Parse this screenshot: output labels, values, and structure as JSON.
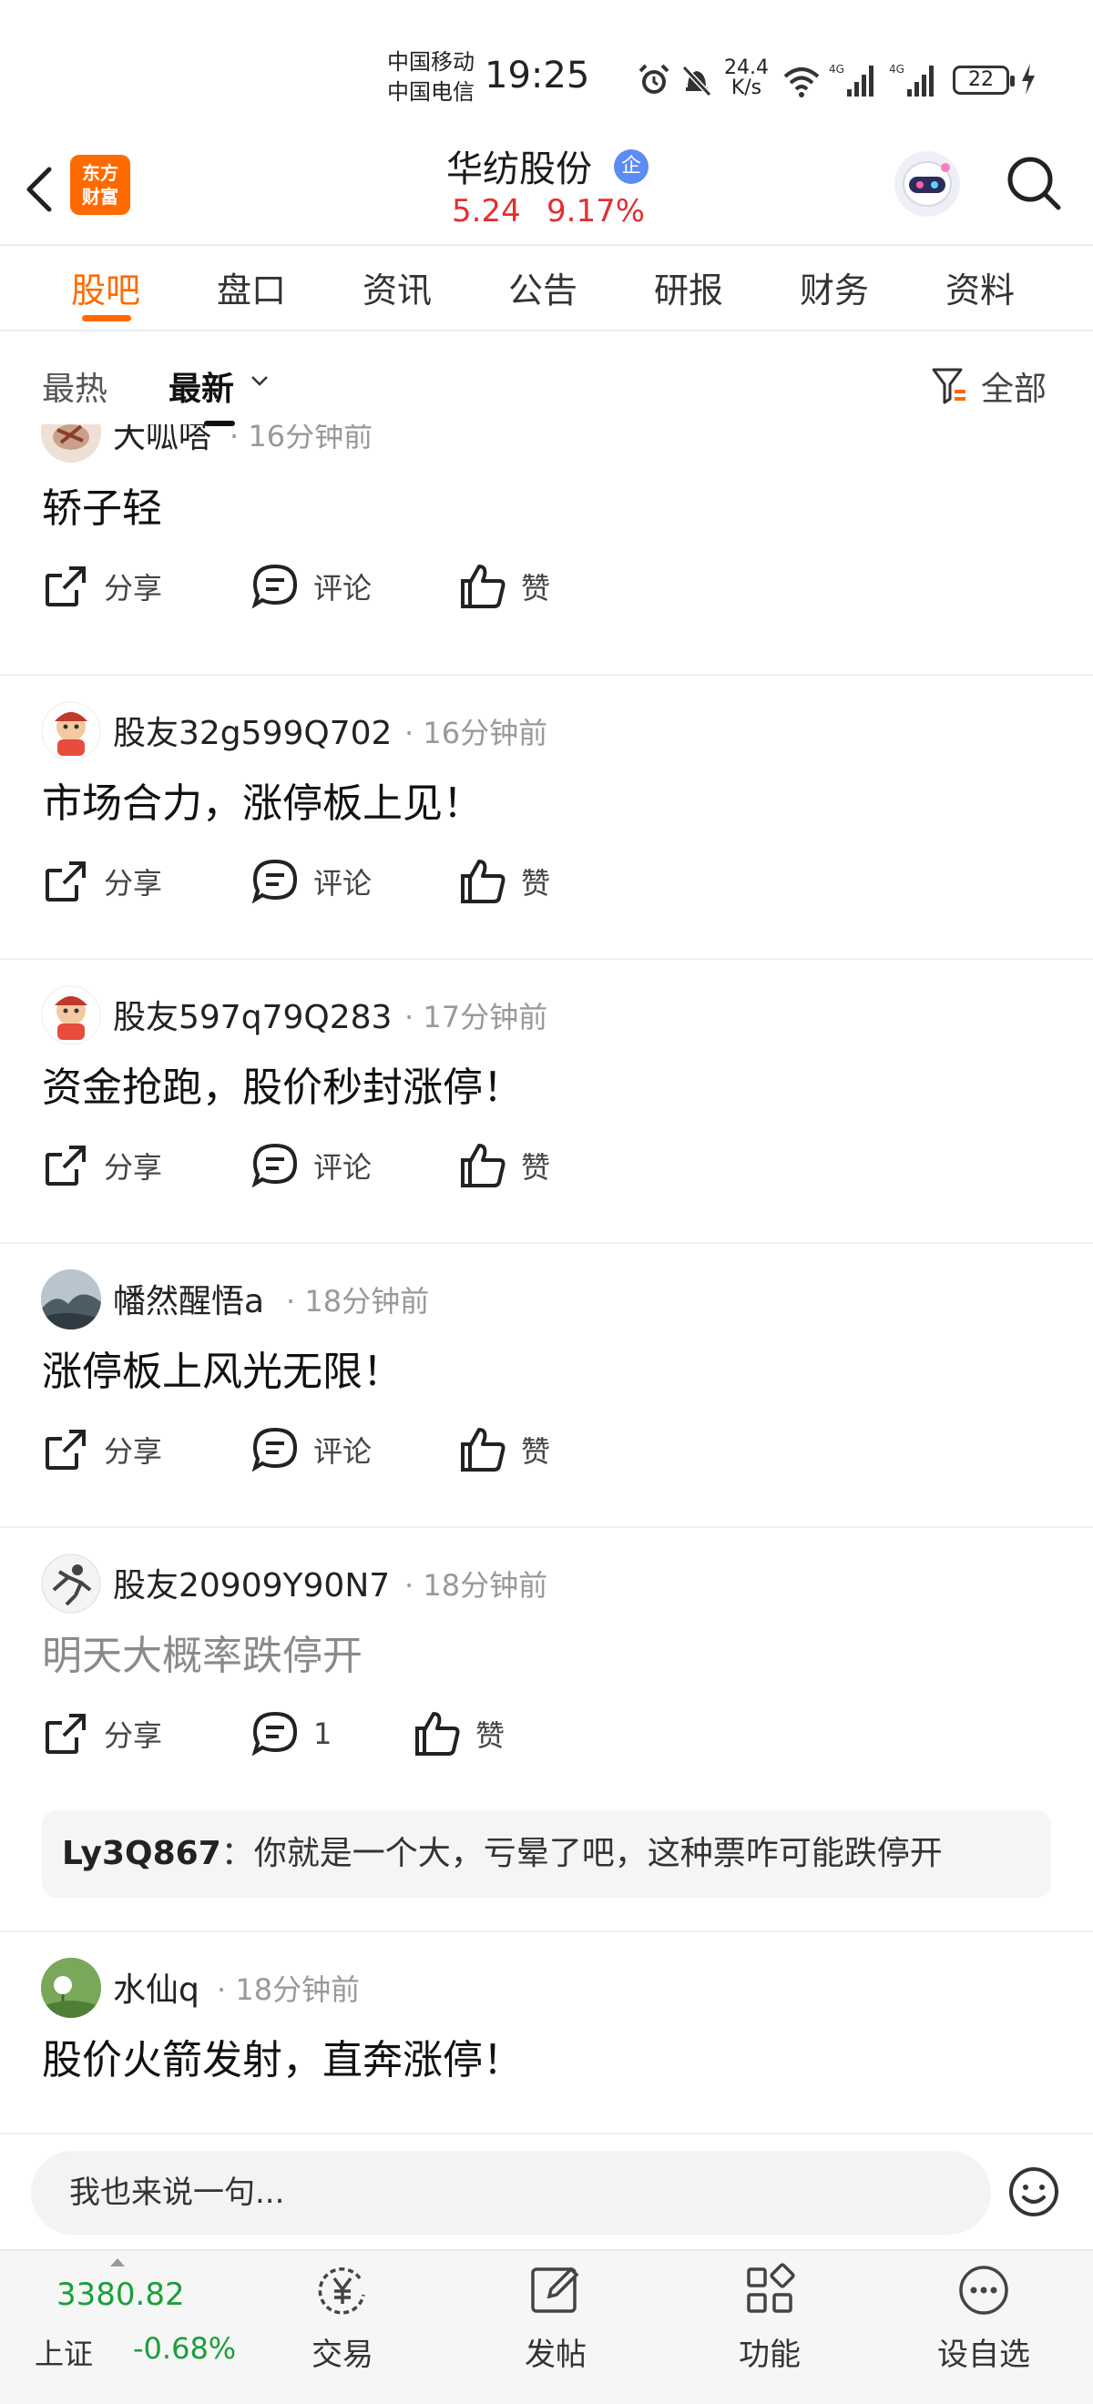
{
  "status_bar": {
    "carrier_1": "中国移动",
    "carrier_2": "中国电信",
    "time": "19:25",
    "net_speed_value": "24.4",
    "net_speed_unit": "K/s",
    "battery": "22"
  },
  "header": {
    "logo_text_1": "东方",
    "logo_text_2": "财富",
    "stock_name": "华纺股份",
    "badge": "企",
    "price": "5.24",
    "change_pct": "9.17%"
  },
  "tabs": [
    {
      "label": "股吧",
      "active": true
    },
    {
      "label": "盘口"
    },
    {
      "label": "资讯"
    },
    {
      "label": "公告"
    },
    {
      "label": "研报"
    },
    {
      "label": "财务"
    },
    {
      "label": "资料"
    }
  ],
  "sort": {
    "hot": "最热",
    "new": "最新",
    "filter": "全部"
  },
  "actions": {
    "share": "分享",
    "comment": "评论",
    "like": "赞"
  },
  "posts": [
    {
      "author": "大呱嗒",
      "time": "16分钟前",
      "content": "轿子轻",
      "comment_count": ""
    },
    {
      "author": "股友32g599Q702",
      "time": "16分钟前",
      "content": "市场合力，涨停板上见！",
      "comment_count": ""
    },
    {
      "author": "股友597q79Q283",
      "time": "17分钟前",
      "content": "资金抢跑，股价秒封涨停！",
      "comment_count": ""
    },
    {
      "author": "幡然醒悟a",
      "time": "18分钟前",
      "content": "涨停板上风光无限！",
      "comment_count": ""
    },
    {
      "author": "股友20909Y90N7",
      "time": "18分钟前",
      "content": "明天大概率跌停开",
      "comment_count": "1",
      "reply": {
        "user": "Ly3Q867",
        "text": "：你就是一个大，亏晕了吧，这种票咋可能跌停开"
      }
    },
    {
      "author": "水仙q",
      "time": "18分钟前",
      "content": "股价火箭发射，直奔涨停！",
      "comment_count": ""
    }
  ],
  "input": {
    "placeholder": "我也来说一句..."
  },
  "bottom_nav": {
    "index_value": "3380.82",
    "index_name": "上证",
    "index_change": "-0.68%",
    "items": [
      {
        "label": "交易",
        "icon": "yen-refresh-icon"
      },
      {
        "label": "发帖",
        "icon": "edit-post-icon"
      },
      {
        "label": "功能",
        "icon": "grid-icon"
      },
      {
        "label": "设自选",
        "icon": "more-dots-icon"
      }
    ]
  },
  "colors": {
    "accent": "#ff6a00",
    "rise": "#e03030",
    "fall": "#1a9e3a"
  }
}
